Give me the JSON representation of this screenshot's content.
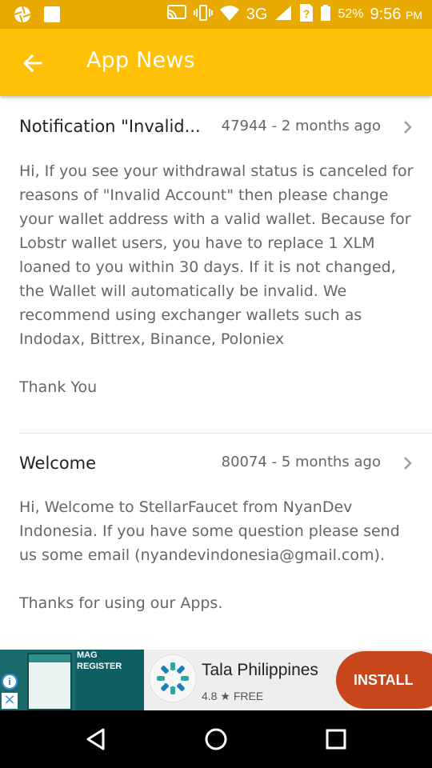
{
  "status_bar": {
    "network": "3G",
    "battery": "52%",
    "time": "9:56",
    "ampm": "PM"
  },
  "toolbar": {
    "title": "App News"
  },
  "news": [
    {
      "title": "Notification \"Invalid...",
      "meta": "47944 - 2 months ago",
      "body": "Hi, If you see your withdrawal status is canceled for reasons of \"Invalid Account\" then please change your wallet address with a valid wallet. Because for Lobstr wallet users, you have to replace 1 XLM loaned to you within 30 days. If it is not changed, the Wallet will automatically be invalid. We recommend using exchanger wallets such as Indodax, Bittrex, Binance, Poloniex\n\nThank You"
    },
    {
      "title": "Welcome",
      "meta": "80074 - 5 months ago",
      "body": "Hi, Welcome to StellarFaucet from NyanDev Indonesia. If you have some question please send us some email (nyandevindonesia@gmail.com).\n\nThanks for using our Apps."
    }
  ],
  "ad": {
    "image_text_line1": "MAG",
    "image_text_line2": "REGISTER",
    "app_name": "Tala Philippines",
    "rating": "4.8",
    "price": "FREE",
    "install_label": "INSTALL"
  },
  "colors": {
    "toolbar": "#FFC107",
    "status_bar": "#E8A900",
    "install_button": "#C8461C"
  }
}
